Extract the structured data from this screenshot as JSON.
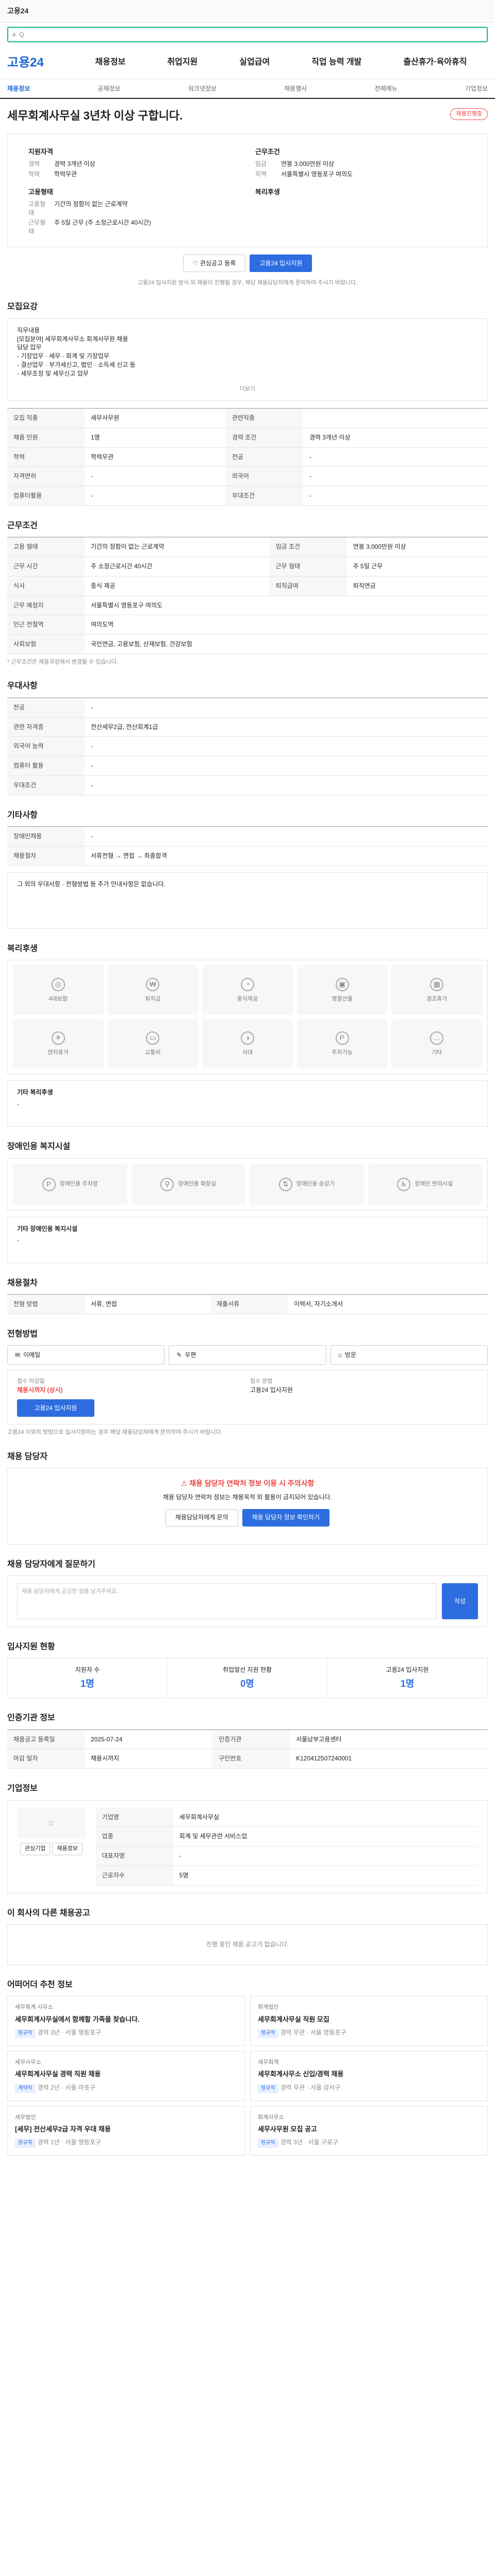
{
  "browser": {
    "title": "고용24"
  },
  "search": {
    "placeholder": "Q"
  },
  "gnb": {
    "logo": "고용24",
    "menu": [
      "채용정보",
      "취업지원",
      "실업급여",
      "직업 능력 개발",
      "출산휴가·육아휴직"
    ]
  },
  "subnav": {
    "items": [
      "채용정보",
      "공채정보",
      "워크넷정보",
      "채용행사",
      "전체메뉴",
      "기업정보"
    ],
    "active": 0
  },
  "job": {
    "title": "세무회계사무실 3년차 이상 구합니다.",
    "badge": "채용진행중",
    "summary": {
      "left_title": "지원자격",
      "left": [
        {
          "k": "경력",
          "v": "경력 3개년 이상"
        },
        {
          "k": "학력",
          "v": "학력무관"
        }
      ],
      "right_title": "근무조건",
      "right": [
        {
          "k": "임금",
          "v": "연봉 3,000만원 이상"
        },
        {
          "k": "지역",
          "v": "서울특별시 영등포구 여의도"
        }
      ],
      "left2_title": "고용형태",
      "left2": [
        {
          "k": "고용형태",
          "v": "기간의 정함이 없는 근로계약"
        },
        {
          "k": "근무형태",
          "v": "주 5일 근무 (주 소정근로시간 40시간)"
        }
      ],
      "right2_title": "복리후생",
      "right2": []
    },
    "notice": "고용24 입사지원 방식 외 채용이 진행될 경우, 해당 채용담당자에게 문의하여 주시기 바랍니다.",
    "btn_fav": "관심공고 등록",
    "btn_apply": "고용24 입사지원"
  },
  "recruit": {
    "title": "모집요강",
    "desc_lines": [
      "직무내용",
      "[모집분야] 세무회계사무소 회계사무원 채용",
      "담당 업무",
      "- 기장업무 · 세무 · 회계 및 기장업무",
      "- 결산업무 · 부가세신고, 법인 · 소득세 신고 등",
      "- 세무조정 및 세무신고 업무"
    ],
    "more": "더보기",
    "rows": [
      {
        "k": "모집 직종",
        "v": "세무사무원",
        "k2": "관련직종",
        "v2": ""
      },
      {
        "k": "채용 인원",
        "v": "1명",
        "k2": "경력 조건",
        "v2": "경력 3개년 이상"
      },
      {
        "k": "학력",
        "v": "학력무관",
        "k2": "전공",
        "v2": "-"
      },
      {
        "k": "자격면허",
        "v": "-",
        "k2": "외국어",
        "v2": "-"
      },
      {
        "k": "컴퓨터활용",
        "v": "-",
        "k2": "우대조건",
        "v2": "-"
      }
    ]
  },
  "cond": {
    "title": "근무조건",
    "rows": [
      {
        "k": "고용 형태",
        "v": "기간의 정함이 없는 근로계약",
        "k2": "임금 조건",
        "v2": "연봉 3,000만원 이상"
      },
      {
        "k": "근무 시간",
        "v": "주 소정근로시간 40시간",
        "k2": "근무 형태",
        "v2": "주 5일 근무"
      },
      {
        "k": "식사",
        "v": "중식 제공",
        "k2": "퇴직급여",
        "v2": "퇴직연금"
      },
      {
        "k": "근무 예정지",
        "v": "서울특별시 영등포구 여의도",
        "k2": "",
        "v2": ""
      },
      {
        "k": "인근 전철역",
        "v": "여의도역",
        "k2": "",
        "v2": ""
      },
      {
        "k": "사회보험",
        "v": "국민연금, 고용보험, 산재보험, 건강보험",
        "k2": "",
        "v2": ""
      }
    ],
    "note": "* 근무조건은 채용과정에서 변경될 수 있습니다."
  },
  "pref": {
    "title": "우대사항",
    "rows": [
      {
        "k": "전공",
        "v": "-"
      },
      {
        "k": "관련 자격증",
        "v": "전산세무2급, 전산회계1급"
      },
      {
        "k": "외국어 능력",
        "v": "-"
      },
      {
        "k": "컴퓨터 활용",
        "v": "-"
      },
      {
        "k": "우대조건",
        "v": "-"
      }
    ]
  },
  "etc": {
    "title": "기타사항",
    "rows": [
      {
        "k": "장애인채용",
        "v": "-"
      },
      {
        "k": "채용절차",
        "v": "서류전형 → 면접 → 최종합격"
      }
    ],
    "box": "그 외의 우대사항 · 전형방법 등 추가 안내사항은 없습니다."
  },
  "welfare": {
    "title": "복리후생",
    "tiles": [
      "4대보험",
      "퇴직금",
      "중식제공",
      "명절선물",
      "경조휴가",
      "연차휴가",
      "교통비",
      "식대",
      "주차가능",
      "기타"
    ],
    "box_title": "기타 복리후생",
    "box": "-"
  },
  "disabled": {
    "title": "장애인용 복지시설",
    "tiles": [
      "장애인용 주차장",
      "장애인용 화장실",
      "장애인용 승강기",
      "장애인 편의시설"
    ],
    "box_title": "기타 장애인용 복지시설",
    "box": "-"
  },
  "process": {
    "title": "채용절차",
    "rows": [
      {
        "k": "전형 방법",
        "v": "서류, 면접",
        "k2": "제출서류",
        "v2": "이력서, 자기소개서"
      }
    ]
  },
  "apply": {
    "title": "전형방법",
    "methods": [
      "이메일",
      "우편",
      "방문"
    ],
    "deadline_label": "접수 마감일",
    "deadline": "채용시까지 (상시)",
    "docs_label": "접수 방법",
    "docs": "고용24 입사지원",
    "btn": "고용24 입사지원",
    "notice": "고용24 이외의 방법으로 입사지원하는 경우 해당 채용담당자에게 문의하여 주시기 바랍니다."
  },
  "manager": {
    "title": "채용 담당자",
    "warn": "채용 담당자 연락처 정보 이용 시 주의사항",
    "desc": "채용 담당자 연락처 정보는 채용목적 외 활용이 금지되어 있습니다.",
    "btn1": "채용담당자에게 문의",
    "btn2": "채용 담당자 정보 확인하기"
  },
  "qna": {
    "title": "채용 담당자에게 질문하기",
    "placeholder": "채용 담당자에게 궁금한 점을 남겨주세요.",
    "btn": "작성"
  },
  "stats": {
    "title": "입사지원 현황",
    "items": [
      {
        "label": "지원자 수",
        "v": "1명"
      },
      {
        "label": "취업알선 지원 현황",
        "v": "0명"
      },
      {
        "label": "고용24 입사지원",
        "v": "1명"
      }
    ]
  },
  "info": {
    "title": "인증기관 정보",
    "rows": [
      {
        "k": "채용공고 등록일",
        "v": "2025-07-24",
        "k2": "인증기관",
        "v2": "서울남부고용센터"
      },
      {
        "k": "마감 일자",
        "v": "채용시까지",
        "k2": "구인번호",
        "v2": "K120412507240001"
      }
    ]
  },
  "company": {
    "title": "기업정보",
    "rows": [
      {
        "k": "기업명",
        "v": "세무회계사무실"
      },
      {
        "k": "업종",
        "v": "회계 및 세무관련 서비스업"
      },
      {
        "k": "대표자명",
        "v": "-"
      },
      {
        "k": "근로자수",
        "v": "5명"
      }
    ],
    "btn1": "관심기업",
    "btn2": "채용정보"
  },
  "related": {
    "title": "이 회사의 다른 채용공고",
    "empty": "진행 중인 채용 공고가 없습니다."
  },
  "recommend": {
    "title": "어떠어더 추천 정보",
    "cards": [
      {
        "co": "세무회계 사무소",
        "tt": "세무회계사무실에서 함께할 가족을 찾습니다.",
        "meta": "경력 3년 · 서울 영등포구",
        "tag": "정규직"
      },
      {
        "co": "회계법인",
        "tt": "세무회계사무실 직원 모집",
        "meta": "경력 무관 · 서울 영등포구",
        "tag": "정규직"
      },
      {
        "co": "세무사무소",
        "tt": "세무회계사무실 경력 직원 채용",
        "meta": "경력 2년 · 서울 마포구",
        "tag": "계약직"
      },
      {
        "co": "세무회계",
        "tt": "세무회계사무소 신입/경력 채용",
        "meta": "경력 무관 · 서울 강서구",
        "tag": "정규직"
      },
      {
        "co": "세무법인",
        "tt": "[세무] 전산세무2급 자격 우대 채용",
        "meta": "경력 1년 · 서울 영등포구",
        "tag": "정규직"
      },
      {
        "co": "회계사무소",
        "tt": "세무사무원 모집 공고",
        "meta": "경력 3년 · 서울 구로구",
        "tag": "정규직"
      }
    ]
  }
}
